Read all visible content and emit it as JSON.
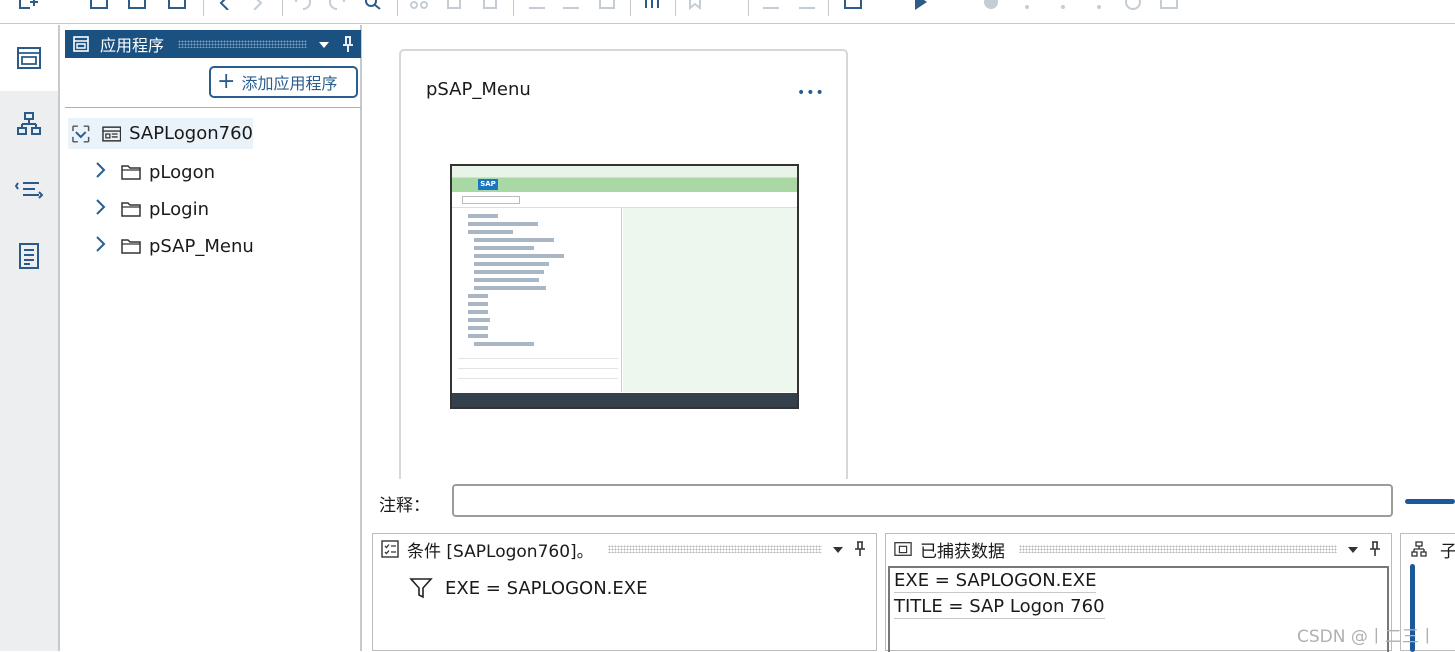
{
  "apps_panel": {
    "title": "应用程序",
    "add_button": "添加应用程序",
    "root": "SAPLogon760",
    "children": [
      "pLogon",
      "pLogin",
      "pSAP_Menu"
    ]
  },
  "card": {
    "title": "pSAP_Menu",
    "more": "•••"
  },
  "note": {
    "label": "注释：",
    "value": ""
  },
  "conditions": {
    "title": "条件 [SAPLogon760]。",
    "items": [
      "EXE = SAPLOGON.EXE"
    ]
  },
  "captured": {
    "title": "已捕获数据",
    "lines": [
      "EXE = SAPLOGON.EXE",
      "TITLE = SAP Logon 760"
    ]
  },
  "sub_panel": {
    "title": "子"
  },
  "watermark": "CSDN @丨二三丨",
  "colors": {
    "accent": "#1b5180",
    "link": "#2a5e8e",
    "rail": "#eceef0"
  }
}
